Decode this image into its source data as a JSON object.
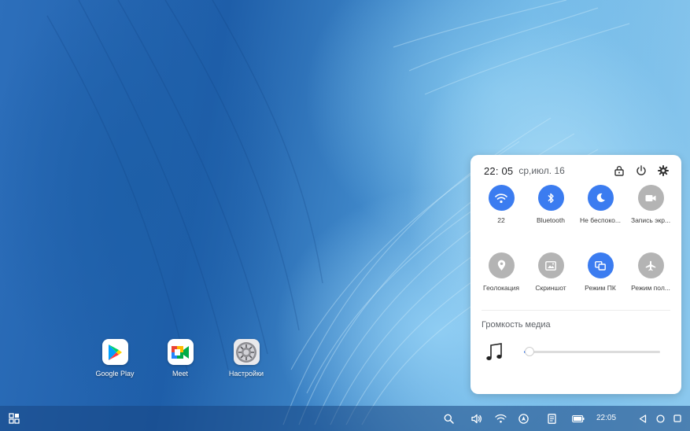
{
  "desktop": {
    "apps": [
      {
        "label": "Google Play",
        "icon": "google-play-icon"
      },
      {
        "label": "Meet",
        "icon": "google-meet-icon"
      },
      {
        "label": "Настройки",
        "icon": "settings-app-icon"
      }
    ]
  },
  "quick_settings": {
    "time": "22: 05",
    "date": "ср,июл. 16",
    "header_icons": [
      "lock-icon",
      "power-icon",
      "gear-icon"
    ],
    "tiles": [
      {
        "label": "22",
        "icon": "wifi-icon",
        "active": true
      },
      {
        "label": "Bluetooth",
        "icon": "bluetooth-icon",
        "active": true
      },
      {
        "label": "Не беспоко...",
        "icon": "moon-icon",
        "active": true
      },
      {
        "label": "Запись экр...",
        "icon": "video-camera-icon",
        "active": false
      },
      {
        "label": "Геолокация",
        "icon": "location-pin-icon",
        "active": false
      },
      {
        "label": "Скриншот",
        "icon": "screenshot-icon",
        "active": false
      },
      {
        "label": "Режим ПК",
        "icon": "desktop-mode-icon",
        "active": true
      },
      {
        "label": "Режим пол...",
        "icon": "airplane-icon",
        "active": false
      }
    ],
    "media": {
      "title": "Громкость медиа",
      "icon": "music-note-icon",
      "volume_fraction": 0.02
    },
    "colors": {
      "active": "#3b7cf0",
      "inactive": "#b4b4b4"
    }
  },
  "taskbar": {
    "clock": "22:05",
    "icons": [
      "app-drawer-icon",
      "search-icon",
      "volume-icon",
      "wifi-icon",
      "navigation-icon",
      "notes-icon",
      "battery-icon",
      "back-icon",
      "home-icon",
      "recents-icon"
    ]
  }
}
